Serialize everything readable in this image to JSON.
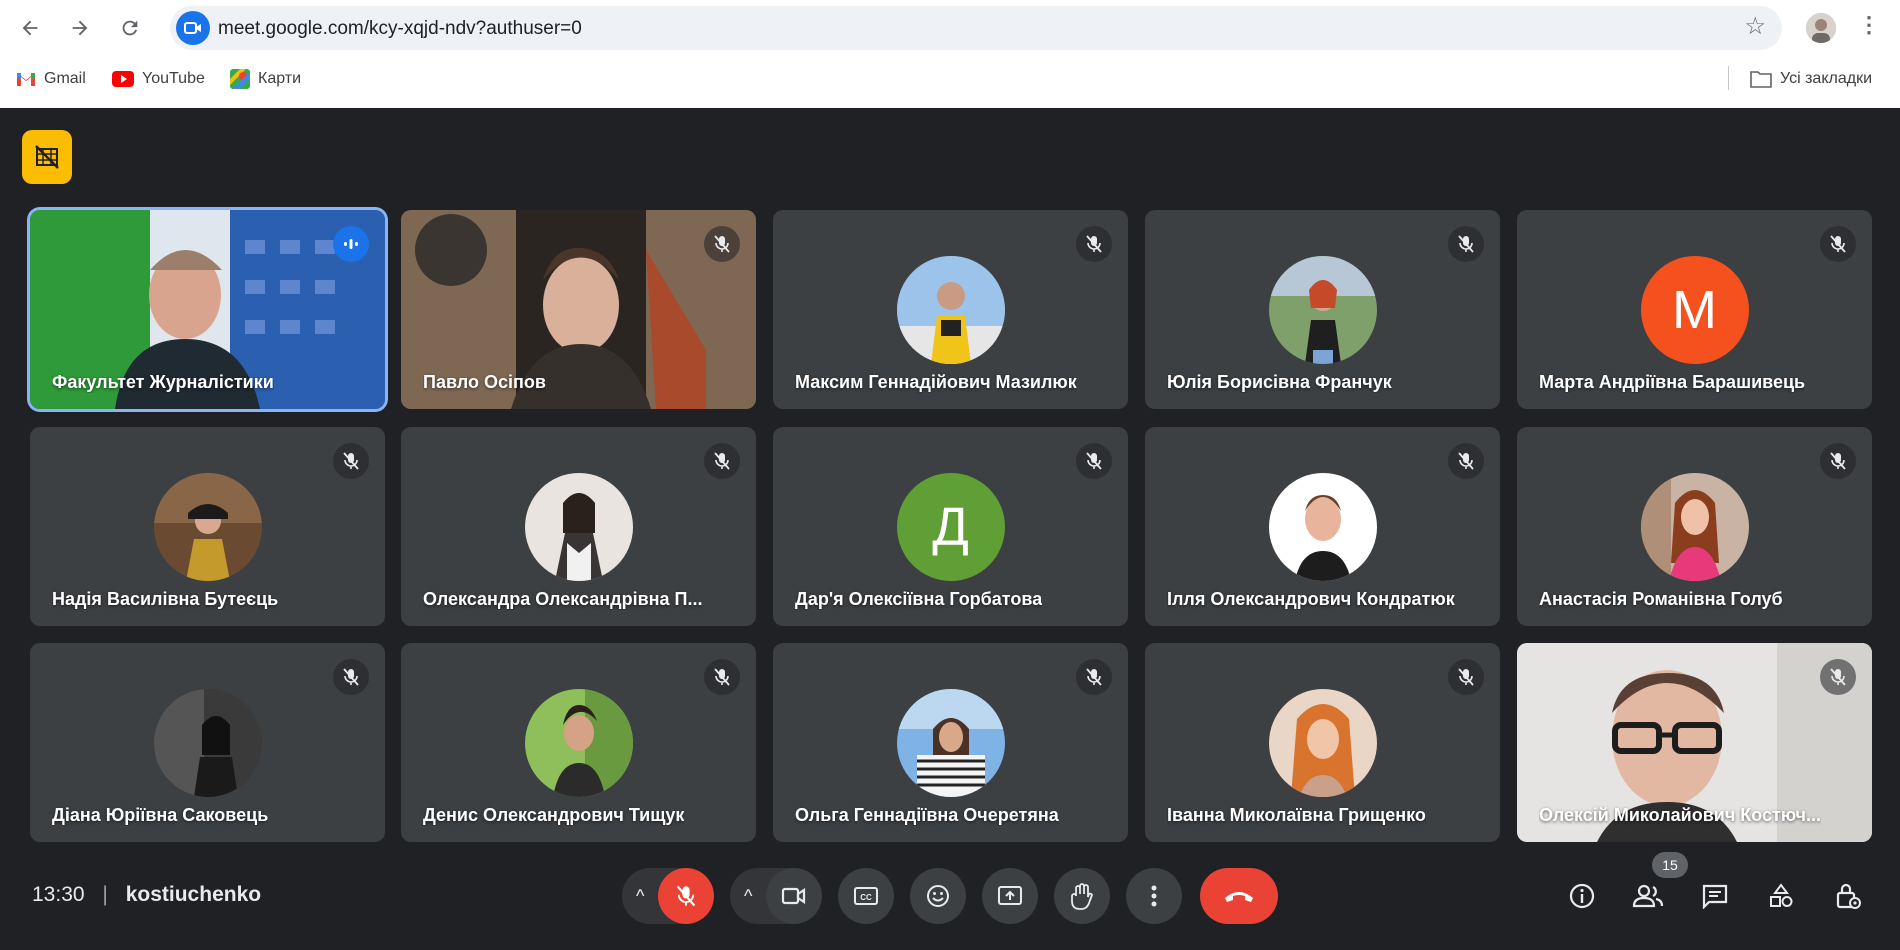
{
  "browser": {
    "url": "meet.google.com/kcy-xqjd-ndv?authuser=0",
    "bookmarks": [
      "Gmail",
      "YouTube",
      "Карти"
    ],
    "all_bookmarks": "Усі закладки"
  },
  "meeting": {
    "time": "13:30",
    "separator": "|",
    "code": "kostiuchenko",
    "participants_count": "15"
  },
  "participants": [
    {
      "name": "Факультет Журналістики",
      "type": "video",
      "state": "speaking"
    },
    {
      "name": "Павло Осіпов",
      "type": "video",
      "state": "muted"
    },
    {
      "name": "Максим Геннадійович Мазилюк",
      "type": "photo",
      "state": "muted"
    },
    {
      "name": "Юлія Борисівна Франчук",
      "type": "photo",
      "state": "muted"
    },
    {
      "name": "Марта Андріївна Барашивець",
      "type": "letter",
      "letter": "M",
      "color": "#f4511e",
      "state": "muted"
    },
    {
      "name": "Надія Василівна Бутеєць",
      "type": "photo",
      "state": "muted"
    },
    {
      "name": "Олександра Олександрівна П...",
      "type": "photo",
      "state": "muted"
    },
    {
      "name": "Дар'я Олексіївна Горбатова",
      "type": "letter",
      "letter": "Д",
      "color": "#5f9f36",
      "state": "muted"
    },
    {
      "name": "Ілля Олександрович Кондратюк",
      "type": "photo",
      "state": "muted"
    },
    {
      "name": "Анастасія Романівна Голуб",
      "type": "photo",
      "state": "muted"
    },
    {
      "name": "Діана Юріївна Саковець",
      "type": "photo",
      "state": "muted"
    },
    {
      "name": "Денис Олександрович Тищук",
      "type": "photo",
      "state": "muted"
    },
    {
      "name": "Ольга Геннадіївна Очеретяна",
      "type": "photo",
      "state": "muted"
    },
    {
      "name": "Іванна Миколаївна Грищенко",
      "type": "photo",
      "state": "muted"
    },
    {
      "name": "Олексій Миколайович Костюч...",
      "type": "video",
      "state": "muted"
    }
  ],
  "colors": {
    "background": "#202124",
    "tile": "#3c4043",
    "accent_blue": "#1a73e8",
    "end_call_red": "#ea4335",
    "warning_yellow": "#fbbc04"
  }
}
